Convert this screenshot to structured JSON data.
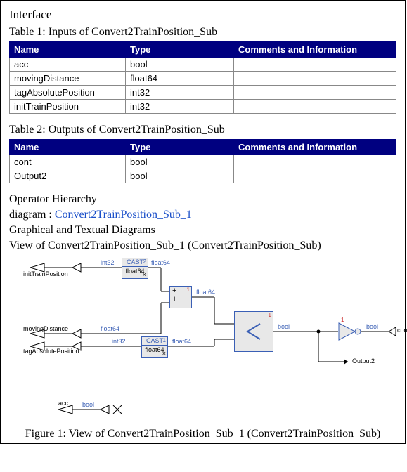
{
  "section_interface_heading": "Interface",
  "table1": {
    "caption": "Table 1: Inputs of Convert2TrainPosition_Sub",
    "headers": {
      "name": "Name",
      "type": "Type",
      "comments": "Comments and Information"
    },
    "rows": [
      {
        "name": "acc",
        "type": "bool",
        "comments": ""
      },
      {
        "name": "movingDistance",
        "type": "float64",
        "comments": ""
      },
      {
        "name": "tagAbsolutePosition",
        "type": "int32",
        "comments": ""
      },
      {
        "name": "initTrainPosition",
        "type": "int32",
        "comments": ""
      }
    ]
  },
  "table2": {
    "caption": "Table 2: Outputs of Convert2TrainPosition_Sub",
    "headers": {
      "name": "Name",
      "type": "Type",
      "comments": "Comments and Information"
    },
    "rows": [
      {
        "name": "cont",
        "type": "bool",
        "comments": ""
      },
      {
        "name": "Output2",
        "type": "bool",
        "comments": ""
      }
    ]
  },
  "hierarchy_heading": "Operator Hierarchy",
  "diagram_link_prefix": "diagram : ",
  "diagram_link_text": "Convert2TrainPosition_Sub_1",
  "diagrams_heading": "Graphical and Textual Diagrams",
  "view_heading": "View of Convert2TrainPosition_Sub_1 (Convert2TrainPosition_Sub)",
  "figure_caption": "Figure 1: View of Convert2TrainPosition_Sub_1 (Convert2TrainPosition_Sub)",
  "diagram": {
    "ports": {
      "initTrainPosition": "initTrainPosition",
      "movingDistance": "movingDistance",
      "tagAbsolutePosition": "tagAbsolutePosition",
      "acc": "acc",
      "cont": "cont",
      "Output2": "Output2"
    },
    "types": {
      "int32": "int32",
      "float64": "float64",
      "bool": "bool"
    },
    "blocks": {
      "cast2": {
        "name": "CAST",
        "index": "2",
        "sub": "float64"
      },
      "cast1": {
        "name": "CAST",
        "index": "1",
        "sub": "float64"
      },
      "add": {
        "symbol_top": "+",
        "symbol_bot": "+",
        "index": "1"
      },
      "compare": {
        "symbol": "<",
        "index": "1"
      },
      "not": {
        "symbol": "NOT",
        "index": "1"
      }
    }
  }
}
